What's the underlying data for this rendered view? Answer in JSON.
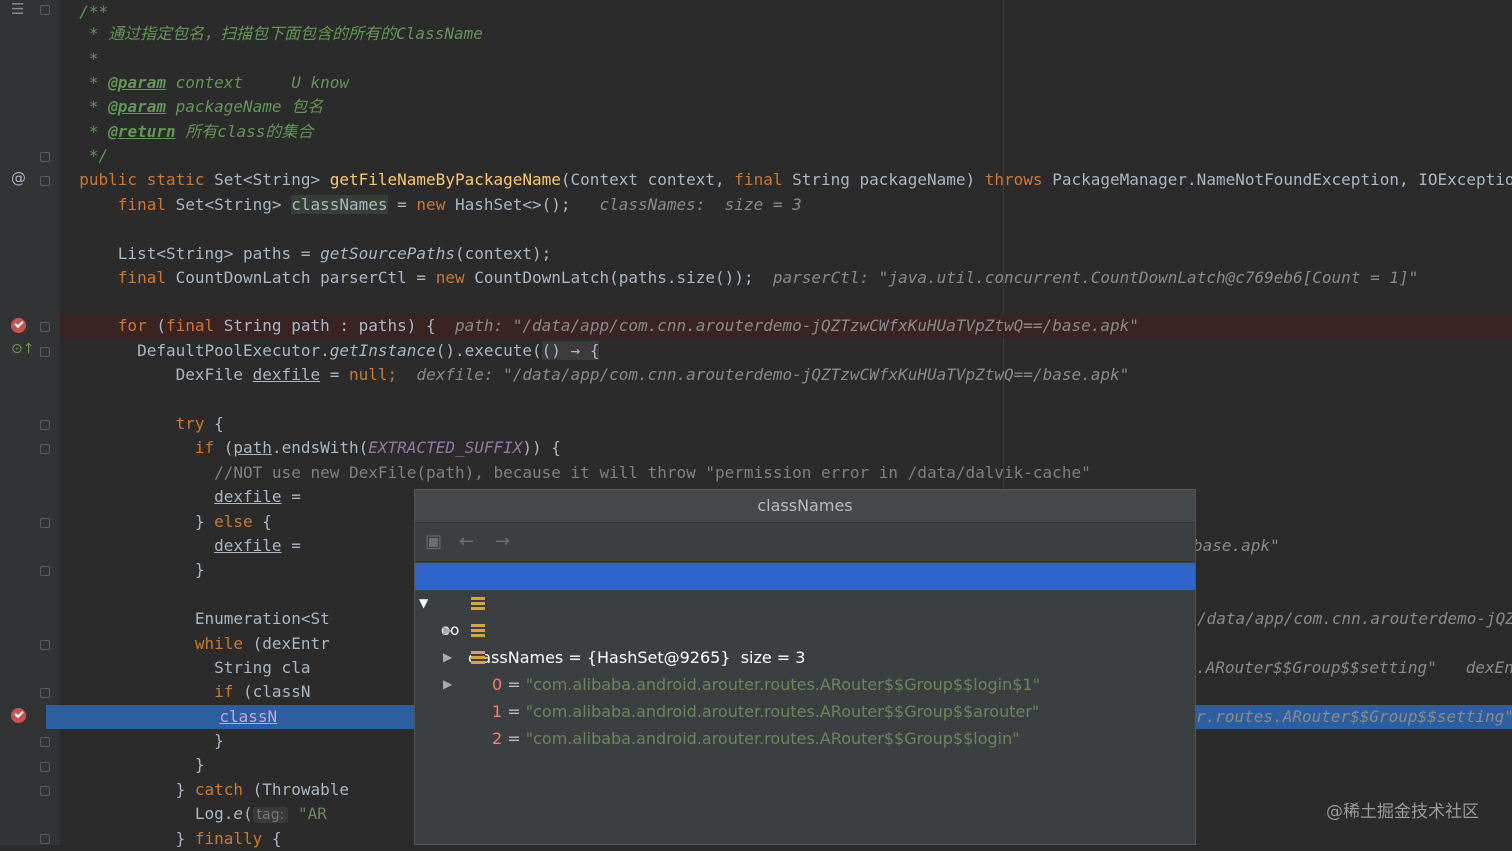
{
  "gutter": {
    "at_symbol": "@"
  },
  "code": {
    "l0": "/**",
    "l1": " * 通过指定包名，扫描包下面包含的所有的ClassName",
    "l2": " *",
    "l3_star": " * ",
    "l3_tag": "@param",
    "l3_rest": " context     U know",
    "l4_star": " * ",
    "l4_tag": "@param",
    "l4_rest": " packageName 包名",
    "l5_star": " * ",
    "l5_tag": "@return",
    "l5_rest": " 所有class的集合",
    "l6": " */",
    "l7_a": "public static ",
    "l7_b": "Set<String> ",
    "l7_m": "getFileNameByPackageName",
    "l7_c": "(Context context, ",
    "l7_k": "final ",
    "l7_d": "String packageName) ",
    "l7_t": "throws ",
    "l7_e": "PackageManager.NameNotFoundException, IOException {",
    "l8_k": "final ",
    "l8_a": "Set<String> ",
    "l8_v": "classNames",
    "l8_b": " = ",
    "l8_n": "new ",
    "l8_c": "HashSet<>();",
    "l8_h": "   classNames:  size = 3",
    "l10_a": "List<String> paths = ",
    "l10_m": "getSourcePaths",
    "l10_b": "(context);",
    "l11_k": "final ",
    "l11_a": "CountDownLatch parserCtl = ",
    "l11_n": "new ",
    "l11_b": "CountDownLatch(paths.size());",
    "l11_h": "  parserCtl: \"java.util.concurrent.CountDownLatch@c769eb6[Count = 1]\"",
    "l13_k": "for ",
    "l13_a": "(",
    "l13_k2": "final ",
    "l13_b": "String path : paths) {",
    "l13_h": "  path: \"/data/app/com.cnn.arouterdemo-jQZTzwCWfxKuHUaTVpZtwQ==/base.apk\"",
    "l14_a": "DefaultPoolExecutor.",
    "l14_m": "getInstance",
    "l14_b": "().execute(",
    "l14_l": "() → {",
    "l15_a": "DexFile ",
    "l15_v": "dexfile",
    "l15_b": " = ",
    "l15_n": "null;",
    "l15_h": "  dexfile: \"/data/app/com.cnn.arouterdemo-jQZTzwCWfxKuHUaTVpZtwQ==/base.apk\"",
    "l17_k": "try ",
    "l17_b": "{",
    "l18_k": "if ",
    "l18_a": "(",
    "l18_v": "path",
    "l18_b": ".endsWith(",
    "l18_c": "EXTRACTED_SUFFIX",
    "l18_d": ")) {",
    "l19": "//NOT use new DexFile(path), because it will throw \"permission error in /data/dalvik-cache\"",
    "l20_v": "dexfile",
    "l20_b": " =",
    "l21_a": "} ",
    "l21_k": "else ",
    "l21_b": "{",
    "l22_v": "dexfile",
    "l22_b": " =",
    "l22_h": "base.apk\"",
    "l23": "}",
    "l25_a": "Enumeration<St",
    "l25_h": "/data/app/com.cnn.arouterdemo-jQZT",
    "l26_k": "while ",
    "l26_a": "(dexEntr",
    "l27_a": "String cla",
    "l27_h": ".ARouter$$Group$$setting\"   dexEntr",
    "l28_k": "if ",
    "l28_a": "(classN",
    "l29_v": "classN",
    "l29_h": "r.routes.ARouter$$Group$$setting\"",
    "l30": "}",
    "l31": "}",
    "l32_a": "} ",
    "l32_k": "catch ",
    "l32_b": "(Throwable",
    "l33_a": "Log.",
    "l33_m": "e",
    "l33_b": "(",
    "l33_p": "tag:",
    "l33_s": " \"AR",
    "l34_a": "} ",
    "l34_k": "finally ",
    "l34_b": "{"
  },
  "popup": {
    "title": "classNames",
    "toolbar": {
      "back_label": "←",
      "forward_label": "→"
    },
    "root": {
      "name": "classNames",
      "eq": " = ",
      "value": "{HashSet@9265}",
      "size": "  size = 3"
    },
    "items": [
      {
        "index": "0",
        "eq": " = ",
        "value": "\"com.alibaba.android.arouter.routes.ARouter$$Group$$login$1\""
      },
      {
        "index": "1",
        "eq": " = ",
        "value": "\"com.alibaba.android.arouter.routes.ARouter$$Group$$arouter\""
      },
      {
        "index": "2",
        "eq": " = ",
        "value": "\"com.alibaba.android.arouter.routes.ARouter$$Group$$login\""
      }
    ]
  },
  "watermark": "@稀土掘金技术社区",
  "colors": {
    "background": "#2b2b2b",
    "keyword": "#cc7832",
    "method": "#ffc66d",
    "string": "#6a8759",
    "selection": "#2f65ca",
    "breakpoint": "#c75450"
  }
}
